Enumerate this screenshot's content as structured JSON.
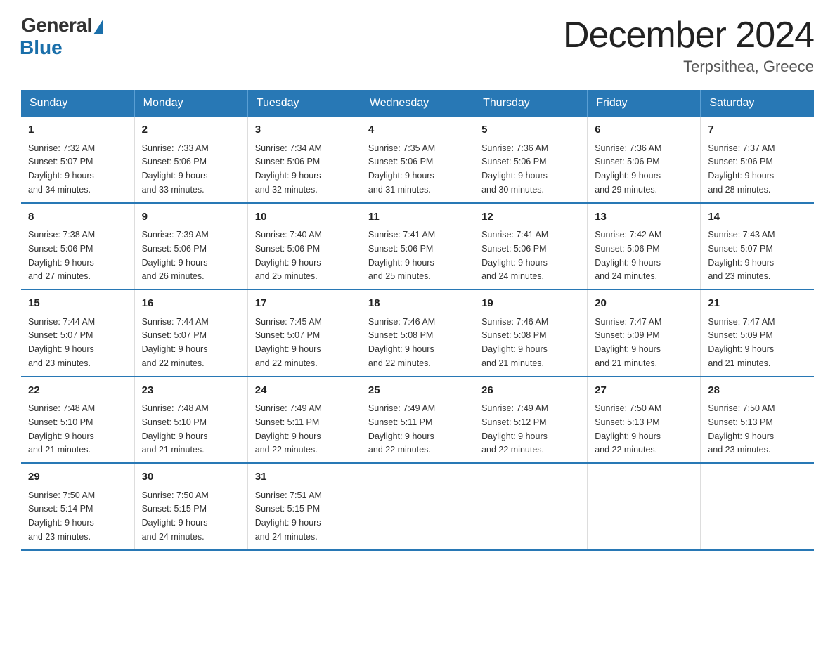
{
  "logo": {
    "general": "General",
    "blue": "Blue"
  },
  "title": "December 2024",
  "location": "Terpsithea, Greece",
  "days_of_week": [
    "Sunday",
    "Monday",
    "Tuesday",
    "Wednesday",
    "Thursday",
    "Friday",
    "Saturday"
  ],
  "weeks": [
    [
      {
        "day": "1",
        "sunrise": "7:32 AM",
        "sunset": "5:07 PM",
        "daylight": "9 hours and 34 minutes."
      },
      {
        "day": "2",
        "sunrise": "7:33 AM",
        "sunset": "5:06 PM",
        "daylight": "9 hours and 33 minutes."
      },
      {
        "day": "3",
        "sunrise": "7:34 AM",
        "sunset": "5:06 PM",
        "daylight": "9 hours and 32 minutes."
      },
      {
        "day": "4",
        "sunrise": "7:35 AM",
        "sunset": "5:06 PM",
        "daylight": "9 hours and 31 minutes."
      },
      {
        "day": "5",
        "sunrise": "7:36 AM",
        "sunset": "5:06 PM",
        "daylight": "9 hours and 30 minutes."
      },
      {
        "day": "6",
        "sunrise": "7:36 AM",
        "sunset": "5:06 PM",
        "daylight": "9 hours and 29 minutes."
      },
      {
        "day": "7",
        "sunrise": "7:37 AM",
        "sunset": "5:06 PM",
        "daylight": "9 hours and 28 minutes."
      }
    ],
    [
      {
        "day": "8",
        "sunrise": "7:38 AM",
        "sunset": "5:06 PM",
        "daylight": "9 hours and 27 minutes."
      },
      {
        "day": "9",
        "sunrise": "7:39 AM",
        "sunset": "5:06 PM",
        "daylight": "9 hours and 26 minutes."
      },
      {
        "day": "10",
        "sunrise": "7:40 AM",
        "sunset": "5:06 PM",
        "daylight": "9 hours and 25 minutes."
      },
      {
        "day": "11",
        "sunrise": "7:41 AM",
        "sunset": "5:06 PM",
        "daylight": "9 hours and 25 minutes."
      },
      {
        "day": "12",
        "sunrise": "7:41 AM",
        "sunset": "5:06 PM",
        "daylight": "9 hours and 24 minutes."
      },
      {
        "day": "13",
        "sunrise": "7:42 AM",
        "sunset": "5:06 PM",
        "daylight": "9 hours and 24 minutes."
      },
      {
        "day": "14",
        "sunrise": "7:43 AM",
        "sunset": "5:07 PM",
        "daylight": "9 hours and 23 minutes."
      }
    ],
    [
      {
        "day": "15",
        "sunrise": "7:44 AM",
        "sunset": "5:07 PM",
        "daylight": "9 hours and 23 minutes."
      },
      {
        "day": "16",
        "sunrise": "7:44 AM",
        "sunset": "5:07 PM",
        "daylight": "9 hours and 22 minutes."
      },
      {
        "day": "17",
        "sunrise": "7:45 AM",
        "sunset": "5:07 PM",
        "daylight": "9 hours and 22 minutes."
      },
      {
        "day": "18",
        "sunrise": "7:46 AM",
        "sunset": "5:08 PM",
        "daylight": "9 hours and 22 minutes."
      },
      {
        "day": "19",
        "sunrise": "7:46 AM",
        "sunset": "5:08 PM",
        "daylight": "9 hours and 21 minutes."
      },
      {
        "day": "20",
        "sunrise": "7:47 AM",
        "sunset": "5:09 PM",
        "daylight": "9 hours and 21 minutes."
      },
      {
        "day": "21",
        "sunrise": "7:47 AM",
        "sunset": "5:09 PM",
        "daylight": "9 hours and 21 minutes."
      }
    ],
    [
      {
        "day": "22",
        "sunrise": "7:48 AM",
        "sunset": "5:10 PM",
        "daylight": "9 hours and 21 minutes."
      },
      {
        "day": "23",
        "sunrise": "7:48 AM",
        "sunset": "5:10 PM",
        "daylight": "9 hours and 21 minutes."
      },
      {
        "day": "24",
        "sunrise": "7:49 AM",
        "sunset": "5:11 PM",
        "daylight": "9 hours and 22 minutes."
      },
      {
        "day": "25",
        "sunrise": "7:49 AM",
        "sunset": "5:11 PM",
        "daylight": "9 hours and 22 minutes."
      },
      {
        "day": "26",
        "sunrise": "7:49 AM",
        "sunset": "5:12 PM",
        "daylight": "9 hours and 22 minutes."
      },
      {
        "day": "27",
        "sunrise": "7:50 AM",
        "sunset": "5:13 PM",
        "daylight": "9 hours and 22 minutes."
      },
      {
        "day": "28",
        "sunrise": "7:50 AM",
        "sunset": "5:13 PM",
        "daylight": "9 hours and 23 minutes."
      }
    ],
    [
      {
        "day": "29",
        "sunrise": "7:50 AM",
        "sunset": "5:14 PM",
        "daylight": "9 hours and 23 minutes."
      },
      {
        "day": "30",
        "sunrise": "7:50 AM",
        "sunset": "5:15 PM",
        "daylight": "9 hours and 24 minutes."
      },
      {
        "day": "31",
        "sunrise": "7:51 AM",
        "sunset": "5:15 PM",
        "daylight": "9 hours and 24 minutes."
      },
      null,
      null,
      null,
      null
    ]
  ],
  "labels": {
    "sunrise": "Sunrise:",
    "sunset": "Sunset:",
    "daylight": "Daylight:"
  }
}
